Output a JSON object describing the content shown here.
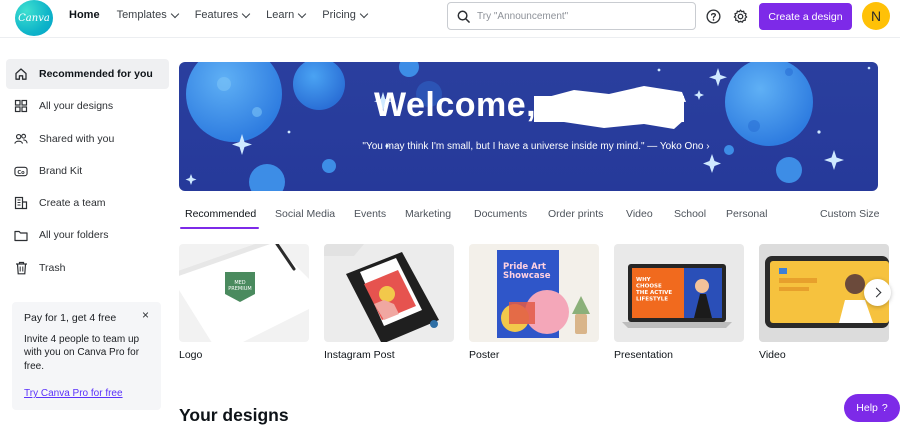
{
  "brand": {
    "logo_text": "Canva",
    "accent": "#7d2ae8",
    "avatar_bg": "#ffc107"
  },
  "topnav": {
    "items": [
      {
        "label": "Home",
        "active": true,
        "dropdown": false
      },
      {
        "label": "Templates",
        "dropdown": true
      },
      {
        "label": "Features",
        "dropdown": true
      },
      {
        "label": "Learn",
        "dropdown": true
      },
      {
        "label": "Pricing",
        "dropdown": true
      }
    ],
    "search_placeholder": "Try \"Announcement\"",
    "create_label": "Create a design",
    "avatar_letter": "N",
    "icons": [
      "search-icon",
      "help-circle-icon",
      "settings-icon"
    ]
  },
  "sidebar": {
    "items": [
      {
        "label": "Recommended for you",
        "icon": "home-icon",
        "active": true
      },
      {
        "label": "All your designs",
        "icon": "grid-icon"
      },
      {
        "label": "Shared with you",
        "icon": "shared-users-icon"
      },
      {
        "label": "Brand Kit",
        "icon": "brand-kit-icon"
      },
      {
        "label": "Create a team",
        "icon": "team-building-icon"
      },
      {
        "label": "All your folders",
        "icon": "folder-icon"
      },
      {
        "label": "Trash",
        "icon": "trash-icon"
      }
    ]
  },
  "promo": {
    "title": "Pay for 1, get 4 free",
    "body": "Invite 4 people to team up with you on Canva Pro for free.",
    "link": "Try Canva Pro for free",
    "close": "×"
  },
  "hero": {
    "welcome": "Welcome,",
    "quote": "\"You may think I'm small, but I have a universe inside my mind.\" — Yoko Ono ›"
  },
  "tabs": [
    {
      "label": "Recommended",
      "active": true
    },
    {
      "label": "Social Media"
    },
    {
      "label": "Events"
    },
    {
      "label": "Marketing"
    },
    {
      "label": "Documents"
    },
    {
      "label": "Order prints"
    },
    {
      "label": "Video"
    },
    {
      "label": "School"
    },
    {
      "label": "Personal"
    },
    {
      "label": "Custom Size"
    }
  ],
  "cards": [
    {
      "label": "Logo",
      "thumb_text": "MED\nPREMIUM"
    },
    {
      "label": "Instagram Post"
    },
    {
      "label": "Poster",
      "thumb_text": "Pride Art\nShowcase"
    },
    {
      "label": "Presentation",
      "thumb_text": "WHY\nCHOOSE\nTHE ACTIVE\nLIFESTYLE"
    },
    {
      "label": "Video"
    }
  ],
  "section_title": "Your designs",
  "help": {
    "label": "Help",
    "icon_text": "?"
  }
}
